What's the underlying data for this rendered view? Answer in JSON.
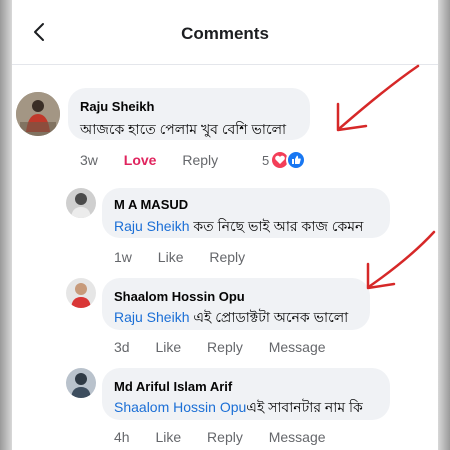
{
  "header": {
    "title": "Comments",
    "back_icon": "chevron-left-icon"
  },
  "comments": [
    {
      "name": "Raju Sheikh",
      "text": "আজকে হাতে পেলাম খুব বেশি ভালো",
      "time": "3w",
      "reaction_label": "Love",
      "reply_label": "Reply",
      "reaction_count": "5"
    },
    {
      "name": "M A MASUD",
      "mention": "Raju Sheikh",
      "text": " কত নিছে ভাই আর কাজ কেমন",
      "time": "1w",
      "like_label": "Like",
      "reply_label": "Reply"
    },
    {
      "name": "Shaalom Hossin Opu",
      "mention": "Raju Sheikh",
      "text": " এই প্রোডাক্টটা অনেক ভালো",
      "time": "3d",
      "like_label": "Like",
      "reply_label": "Reply",
      "message_label": "Message"
    },
    {
      "name": "Md Ariful Islam Arif",
      "mention": "Shaalom Hossin Opu",
      "text": "এই সাবানটার নাম কি",
      "time": "4h",
      "like_label": "Like",
      "reply_label": "Reply",
      "message_label": "Message"
    }
  ],
  "colors": {
    "mention": "#1b6fd6",
    "love": "#e0245e",
    "annotation_arrow": "#d62828"
  }
}
